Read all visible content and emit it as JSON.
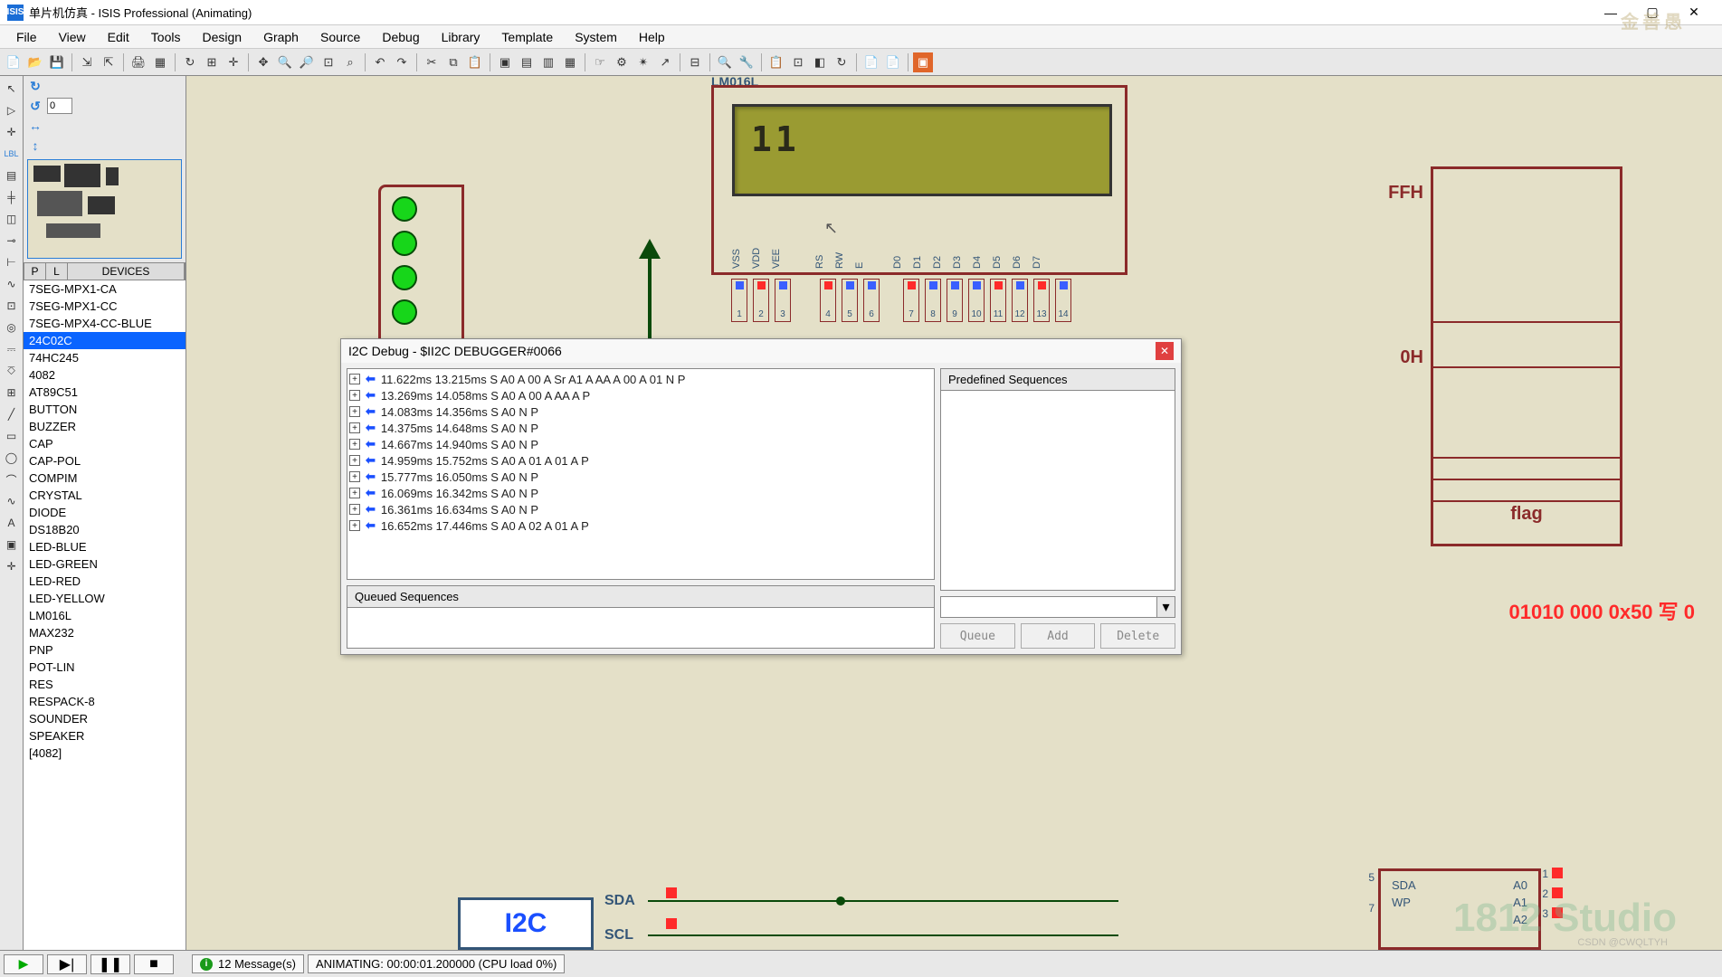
{
  "window": {
    "title": "单片机仿真 - ISIS Professional (Animating)",
    "icon_text": "ISIS"
  },
  "menu": [
    "File",
    "View",
    "Edit",
    "Tools",
    "Design",
    "Graph",
    "Source",
    "Debug",
    "Library",
    "Template",
    "System",
    "Help"
  ],
  "left_panel": {
    "spin_value": "0",
    "device_header": {
      "p": "P",
      "l": "L",
      "devices": "DEVICES"
    },
    "devices": [
      "7SEG-MPX1-CA",
      "7SEG-MPX1-CC",
      "7SEG-MPX4-CC-BLUE",
      "24C02C",
      "74HC245",
      "4082",
      "AT89C51",
      "BUTTON",
      "BUZZER",
      "CAP",
      "CAP-POL",
      "COMPIM",
      "CRYSTAL",
      "DIODE",
      "DS18B20",
      "LED-BLUE",
      "LED-GREEN",
      "LED-RED",
      "LED-YELLOW",
      "LM016L",
      "MAX232",
      "PNP",
      "POT-LIN",
      "RES",
      "RESPACK-8",
      "SOUNDER",
      "SPEAKER",
      "[4082]"
    ],
    "selected_index": 3
  },
  "lcd": {
    "part_label": "LM016L",
    "display_text": "11",
    "pin_labels_top": [
      "VSS",
      "VDD",
      "VEE",
      "RS",
      "RW",
      "E",
      "D0",
      "D1",
      "D2",
      "D3",
      "D4",
      "D5",
      "D6",
      "D7"
    ],
    "pin_numbers": [
      "1",
      "2",
      "3",
      "4",
      "5",
      "6",
      "7",
      "8",
      "9",
      "10",
      "11",
      "12",
      "13",
      "14"
    ],
    "pin_colors": [
      "blue",
      "red",
      "blue",
      "red",
      "blue",
      "blue",
      "red",
      "blue",
      "blue",
      "blue",
      "red",
      "blue",
      "red",
      "blue"
    ]
  },
  "memory": {
    "top_label": "FFH",
    "mid_label": "0H",
    "flag_label": "flag"
  },
  "hex_annotation": "01010 000  0x50   写 0",
  "debug_window": {
    "title": "I2C Debug - $II2C DEBUGGER#0066",
    "predefined_header": "Predefined Sequences",
    "queued_header": "Queued Sequences",
    "buttons": {
      "queue": "Queue",
      "add": "Add",
      "delete": "Delete"
    },
    "log": [
      "11.622ms  13.215ms S A0 A 00 A Sr A1 A AA A 00 A 01 N P",
      "13.269ms  14.058ms S A0 A 00 A AA A P",
      "14.083ms  14.356ms S A0 N P",
      "14.375ms  14.648ms S A0 N P",
      "14.667ms  14.940ms S A0 N P",
      "14.959ms  15.752ms S A0 A 01 A 01 A P",
      "15.777ms  16.050ms S A0 N P",
      "16.069ms  16.342ms S A0 N P",
      "16.361ms  16.634ms S A0 N P",
      "16.652ms  17.446ms S A0 A 02 A 01 A P"
    ]
  },
  "bus": {
    "i2c_label": "I2C",
    "sda": "SDA",
    "scl": "SCL",
    "eeprom_left_pins": [
      "SDA",
      "WP"
    ],
    "eeprom_right_pins": [
      "A0",
      "A1",
      "A2"
    ],
    "eeprom_nums_left": [
      "5",
      "7"
    ],
    "eeprom_nums_right": [
      "1",
      "2",
      "3"
    ]
  },
  "status": {
    "messages": "12 Message(s)",
    "animating": "ANIMATING: 00:00:01.200000 (CPU load 0%)"
  },
  "watermark": "金善愚",
  "watermark2": "1812 Studio",
  "csdn": "CSDN @CWQLTYH"
}
